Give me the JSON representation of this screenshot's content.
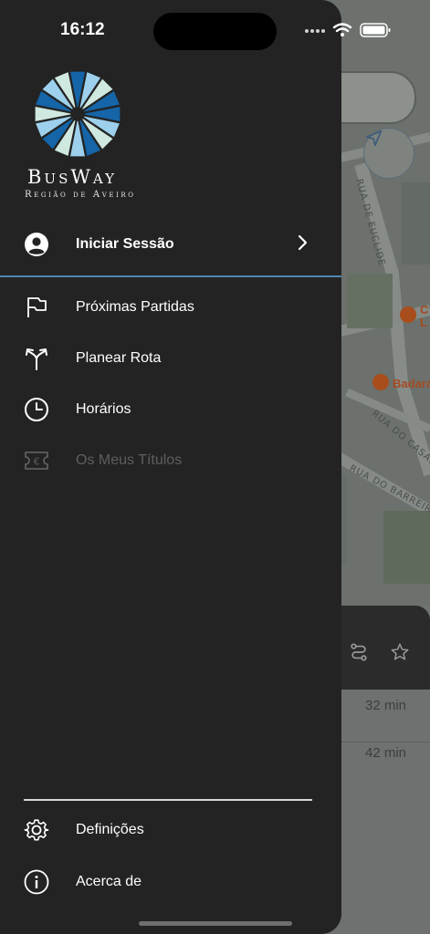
{
  "status_bar": {
    "time": "16:12"
  },
  "brand": {
    "name": "BusWay",
    "subtitle": "Região de Aveiro"
  },
  "login": {
    "label": "Iniciar Sessão"
  },
  "menu": {
    "items": [
      {
        "label": "Próximas Partidas",
        "icon": "flag-icon",
        "enabled": true
      },
      {
        "label": "Planear Rota",
        "icon": "route-split-icon",
        "enabled": true
      },
      {
        "label": "Horários",
        "icon": "clock-icon",
        "enabled": true
      },
      {
        "label": "Os Meus Títulos",
        "icon": "ticket-euro-icon",
        "enabled": false
      }
    ]
  },
  "footer": {
    "settings_label": "Definições",
    "about_label": "Acerca de"
  },
  "map": {
    "poi_1": "C",
    "poi_1b": "L",
    "poi_2": "Badaró",
    "street_1": "RUA DE EUCLIDE",
    "street_2": "RUA DO CASAL",
    "street_3": "RUA DO BARREIRO"
  },
  "results": [
    {
      "duration": "32 min"
    },
    {
      "duration": "42 min"
    }
  ],
  "colors": {
    "drawer_bg": "#232323",
    "accent_divider": "#4d87b3",
    "logo_dark_blue": "#1565a8",
    "logo_light_blue": "#9dd0ec",
    "logo_pale": "#cfe8e0"
  }
}
